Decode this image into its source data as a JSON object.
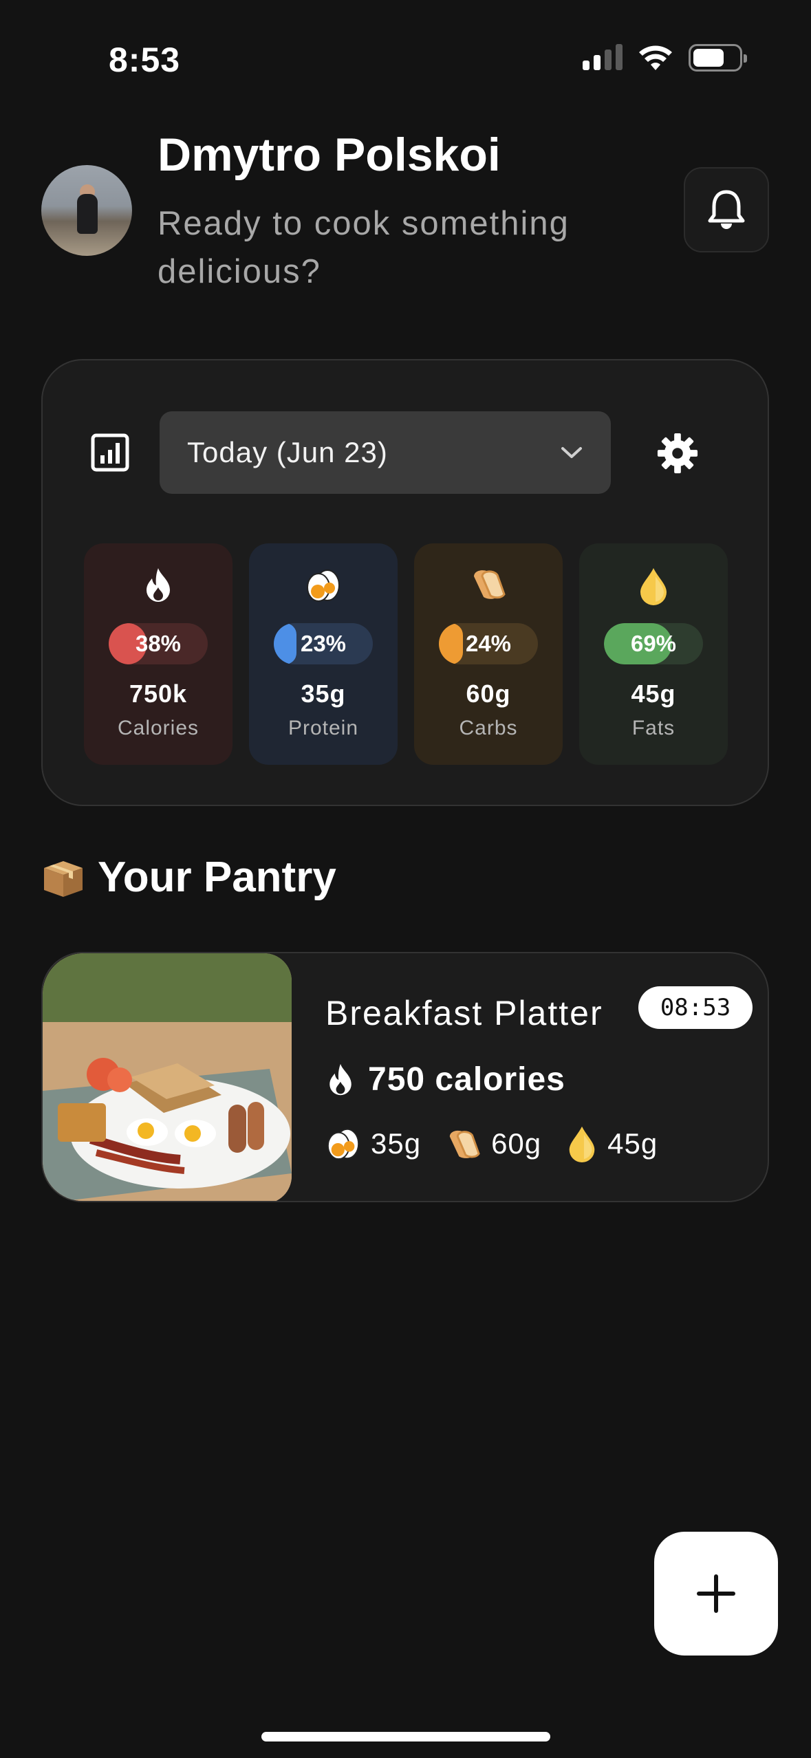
{
  "status_bar": {
    "time": "8:53"
  },
  "header": {
    "user_name": "Dmytro Polskoi",
    "subtitle": "Ready to cook something delicious?"
  },
  "stats": {
    "date_label": "Today (Jun 23)",
    "macros": [
      {
        "key": "calories",
        "label": "Calories",
        "percent_text": "38%",
        "percent": 0.38,
        "amount": "750k",
        "icon": "fire-icon",
        "color": "#d9534f"
      },
      {
        "key": "protein",
        "label": "Protein",
        "percent_text": "23%",
        "percent": 0.23,
        "amount": "35g",
        "icon": "egg-icon",
        "color": "#4d8fe6"
      },
      {
        "key": "carbs",
        "label": "Carbs",
        "percent_text": "24%",
        "percent": 0.24,
        "amount": "60g",
        "icon": "bread-icon",
        "color": "#ee9b33"
      },
      {
        "key": "fats",
        "label": "Fats",
        "percent_text": "69%",
        "percent": 0.69,
        "amount": "45g",
        "icon": "oil-drop-icon",
        "color": "#5aa75c"
      }
    ]
  },
  "pantry": {
    "title": "Your Pantry",
    "items": [
      {
        "name": "Breakfast Platter",
        "time": "08:53",
        "calories": "750 calories",
        "protein": "35g",
        "carbs": "60g",
        "fats": "45g"
      }
    ]
  }
}
